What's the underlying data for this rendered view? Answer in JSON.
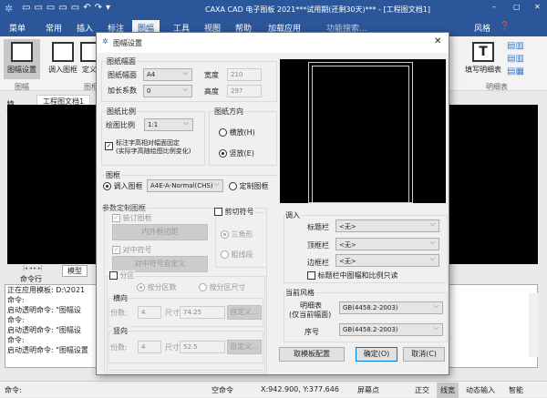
{
  "app": {
    "title": "CAXA CAD 电子图板 2021***试用期(还剩30天)*** - [工程图文档1]"
  },
  "ribbon_tabs": [
    "菜单",
    "常用",
    "插入",
    "标注",
    "图幅",
    "工具",
    "视图",
    "帮助",
    "加载应用"
  ],
  "search_placeholder": "功能搜索...",
  "style_label": "风格",
  "ribbon": {
    "btn_sheet": "图幅设置",
    "btn_load_frame": "调入图框",
    "btn_define": "定义",
    "group_sheet": "图幅",
    "group_frame": "图框",
    "btn_fill_bom": "填写明细表",
    "group_bom": "明细表"
  },
  "doc_tab": "工程图文档1",
  "side_panel": "特性",
  "model_tab": "模型",
  "cmd": {
    "title": "命令行",
    "lines": [
      "正在应用模板: D:\\2021",
      "命令:",
      "启动透明命令: \"图幅设",
      "命令:",
      "启动透明命令: \"图幅设",
      "命令:",
      "启动透明命令: \"图幅设置"
    ],
    "prompt": "命令:"
  },
  "status": {
    "state": "空命令",
    "coords": "X:942.900, Y:377.646",
    "snap": "屏幕点",
    "ortho": "正交",
    "lineweight": "线宽",
    "dynamic": "动态输入",
    "smart": "智能"
  },
  "dialog": {
    "title": "图幅设置",
    "paper": {
      "title": "图纸幅面",
      "size_label": "图纸幅面",
      "size": "A4",
      "ext_label": "加长系数",
      "ext": "0",
      "width_label": "宽度",
      "width": "210",
      "height_label": "高度",
      "height": "297"
    },
    "scale": {
      "title": "图纸比例",
      "label": "绘图比例",
      "value": "1:1",
      "fix_text_1": "标注字高相对幅面固定",
      "fix_text_2": "(实际字高随绘图比例变化)"
    },
    "orient": {
      "title": "图纸方向",
      "landscape": "横放(H)",
      "portrait": "竖放(E)"
    },
    "frame": {
      "title": "图框",
      "load": "调入图框",
      "value": "A4E-A-Normal(CHS)",
      "custom": "定制图框"
    },
    "param": {
      "title": "参数定制图框",
      "binding": "装订图框",
      "margin_btn": "内外框边距",
      "center": "对中符号",
      "center_btn": "对中符号自定义",
      "cut": "剪切符号",
      "triangle": "三角形",
      "thick": "粗线段",
      "zone": "分区",
      "by_count": "按分区数",
      "by_size": "按分区尺寸",
      "horiz": "横向",
      "vert": "竖向",
      "count_label": "份数:",
      "size_label": "尺寸:",
      "h_count": "4",
      "h_size": "74.25",
      "v_count": "4",
      "v_size": "52.5",
      "custom_btn": "自定义..."
    },
    "load": {
      "title": "调入",
      "title_bar": "标题栏",
      "top_bar": "顶框栏",
      "side_bar": "边框栏",
      "title_val": "<无>",
      "top_val": "<无>",
      "side_val": "<无>",
      "readonly": "标题栏中图幅和比例只读"
    },
    "style": {
      "title": "当前风格",
      "bom_1": "明细表",
      "bom_2": "(仅当前幅面)",
      "bom_val": "GB(4458.2-2003)",
      "seq": "序号",
      "seq_val": "GB(4458.2-2003)"
    },
    "buttons": {
      "template": "取模板配置",
      "ok": "确定(O)",
      "cancel": "取消(C)"
    }
  }
}
